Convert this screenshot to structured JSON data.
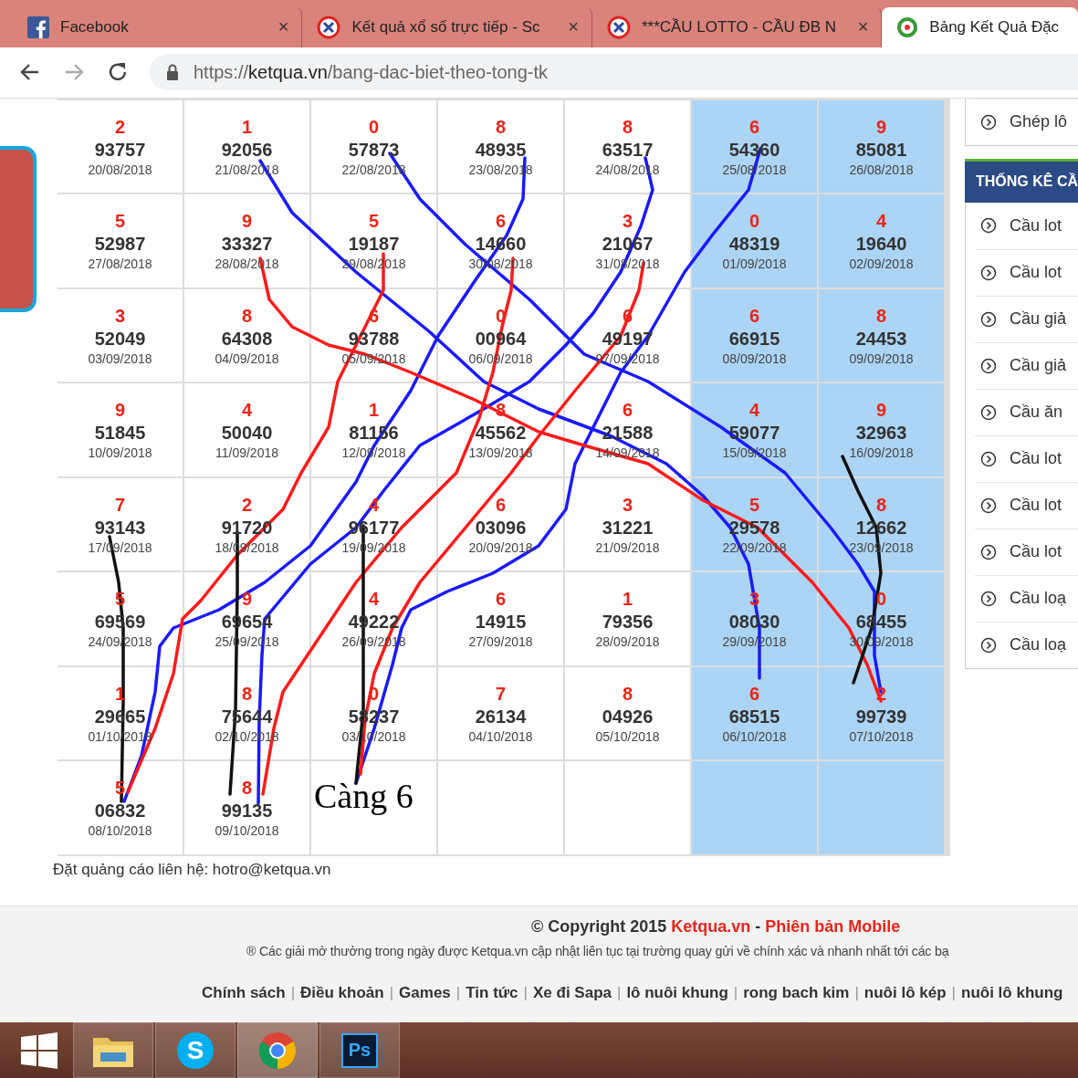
{
  "tabs": [
    {
      "kind": "facebook",
      "title": "Facebook",
      "close": "×",
      "selected": false
    },
    {
      "kind": "lottery",
      "title": "Kết quả xổ số trực tiếp - Sc",
      "close": "×",
      "selected": false
    },
    {
      "kind": "lottery",
      "title": "***CẦU LOTTO - CẦU ĐB N",
      "close": "×",
      "selected": false
    },
    {
      "kind": "site",
      "title": "Bảng Kết Quả Đặc",
      "selected": true
    }
  ],
  "address_bar": {
    "scheme": "https://",
    "host": "ketqua.vn",
    "path": "/bang-dac-biet-theo-tong-tk"
  },
  "table": {
    "columns": [
      {
        "highlighted": false
      },
      {
        "highlighted": false
      },
      {
        "highlighted": false
      },
      {
        "highlighted": false
      },
      {
        "highlighted": false
      },
      {
        "highlighted": true
      },
      {
        "highlighted": true
      }
    ],
    "rows": [
      [
        {
          "sum": "2",
          "number": "93757",
          "date": "20/08/2018"
        },
        {
          "sum": "1",
          "number": "92056",
          "date": "21/08/2018"
        },
        {
          "sum": "0",
          "number": "57873",
          "date": "22/08/2018"
        },
        {
          "sum": "8",
          "number": "48935",
          "date": "23/08/2018"
        },
        {
          "sum": "8",
          "number": "63517",
          "date": "24/08/2018"
        },
        {
          "sum": "6",
          "number": "54360",
          "date": "25/08/2018"
        },
        {
          "sum": "9",
          "number": "85081",
          "date": "26/08/2018"
        }
      ],
      [
        {
          "sum": "5",
          "number": "52987",
          "date": "27/08/2018"
        },
        {
          "sum": "9",
          "number": "33327",
          "date": "28/08/2018"
        },
        {
          "sum": "5",
          "number": "19187",
          "date": "29/08/2018"
        },
        {
          "sum": "6",
          "number": "14660",
          "date": "30/08/2018"
        },
        {
          "sum": "3",
          "number": "21067",
          "date": "31/08/2018"
        },
        {
          "sum": "0",
          "number": "48319",
          "date": "01/09/2018"
        },
        {
          "sum": "4",
          "number": "19640",
          "date": "02/09/2018"
        }
      ],
      [
        {
          "sum": "3",
          "number": "52049",
          "date": "03/09/2018"
        },
        {
          "sum": "8",
          "number": "64308",
          "date": "04/09/2018"
        },
        {
          "sum": "6",
          "number": "93788",
          "date": "05/09/2018"
        },
        {
          "sum": "0",
          "number": "00964",
          "date": "06/09/2018"
        },
        {
          "sum": "6",
          "number": "49197",
          "date": "07/09/2018"
        },
        {
          "sum": "6",
          "number": "66915",
          "date": "08/09/2018"
        },
        {
          "sum": "8",
          "number": "24453",
          "date": "09/09/2018"
        }
      ],
      [
        {
          "sum": "9",
          "number": "51845",
          "date": "10/09/2018"
        },
        {
          "sum": "4",
          "number": "50040",
          "date": "11/09/2018"
        },
        {
          "sum": "1",
          "number": "81156",
          "date": "12/09/2018"
        },
        {
          "sum": "8",
          "number": "45562",
          "date": "13/09/2018"
        },
        {
          "sum": "6",
          "number": "21588",
          "date": "14/09/2018"
        },
        {
          "sum": "4",
          "number": "59077",
          "date": "15/09/2018"
        },
        {
          "sum": "9",
          "number": "32963",
          "date": "16/09/2018"
        }
      ],
      [
        {
          "sum": "7",
          "number": "93143",
          "date": "17/09/2018"
        },
        {
          "sum": "2",
          "number": "91720",
          "date": "18/09/2018"
        },
        {
          "sum": "4",
          "number": "96177",
          "date": "19/09/2018"
        },
        {
          "sum": "6",
          "number": "03096",
          "date": "20/09/2018"
        },
        {
          "sum": "3",
          "number": "31221",
          "date": "21/09/2018"
        },
        {
          "sum": "5",
          "number": "29578",
          "date": "22/09/2018"
        },
        {
          "sum": "8",
          "number": "12662",
          "date": "23/09/2018"
        }
      ],
      [
        {
          "sum": "5",
          "number": "69569",
          "date": "24/09/2018"
        },
        {
          "sum": "9",
          "number": "69654",
          "date": "25/09/2018"
        },
        {
          "sum": "4",
          "number": "49222",
          "date": "26/09/2018"
        },
        {
          "sum": "6",
          "number": "14915",
          "date": "27/09/2018"
        },
        {
          "sum": "1",
          "number": "79356",
          "date": "28/09/2018"
        },
        {
          "sum": "3",
          "number": "08030",
          "date": "29/09/2018"
        },
        {
          "sum": "0",
          "number": "68455",
          "date": "30/09/2018"
        }
      ],
      [
        {
          "sum": "1",
          "number": "29665",
          "date": "01/10/2018"
        },
        {
          "sum": "8",
          "number": "75644",
          "date": "02/10/2018"
        },
        {
          "sum": "0",
          "number": "58237",
          "date": "03/10/2018"
        },
        {
          "sum": "7",
          "number": "26134",
          "date": "04/10/2018"
        },
        {
          "sum": "8",
          "number": "04926",
          "date": "05/10/2018"
        },
        {
          "sum": "6",
          "number": "68515",
          "date": "06/10/2018"
        },
        {
          "sum": "2",
          "number": "99739",
          "date": "07/10/2018"
        }
      ],
      [
        {
          "sum": "5",
          "number": "06832",
          "date": "08/10/2018"
        },
        {
          "sum": "8",
          "number": "99135",
          "date": "09/10/2018"
        }
      ]
    ],
    "handwritten_note": "Càng 6"
  },
  "contact_line": "Đặt quảng cáo liên hệ: hotro@ketqua.vn",
  "sidebar": {
    "top_items": [
      "Ghép lô"
    ],
    "section_title": "THỐNG KÊ CẦ",
    "items": [
      "Cầu lot",
      "Cầu lot",
      "Cầu giả",
      "Cầu giả",
      "Cầu ăn",
      "Cầu lot",
      "Cầu lot",
      "Cầu lot",
      "Cầu loạ",
      "Cầu loạ"
    ]
  },
  "footer": {
    "copyright": "© Copyright 2015",
    "site_link": "Ketqua.vn",
    "separator": "-",
    "mobile_link": "Phiên bản Mobile",
    "notice": "® Các giải mở thưởng trong ngày được Ketqua.vn cập nhật liên tục tại trường quay gửi về chính xác và nhanh nhất tới các bạ",
    "link_separator": "|",
    "links": [
      "Chính sách",
      "Điều khoản",
      "Games",
      "Tin tức",
      "Xe đi Sapa",
      "lô nuôi khung",
      "rong bach kim",
      "nuôi lô kép",
      "nuôi lô khung"
    ]
  },
  "taskbar": [
    {
      "kind": "start"
    },
    {
      "kind": "folder",
      "selected": false
    },
    {
      "kind": "skype",
      "label": "S",
      "selected": false
    },
    {
      "kind": "chrome",
      "selected": true
    },
    {
      "kind": "photoshop",
      "label": "Ps",
      "selected": false
    }
  ]
}
